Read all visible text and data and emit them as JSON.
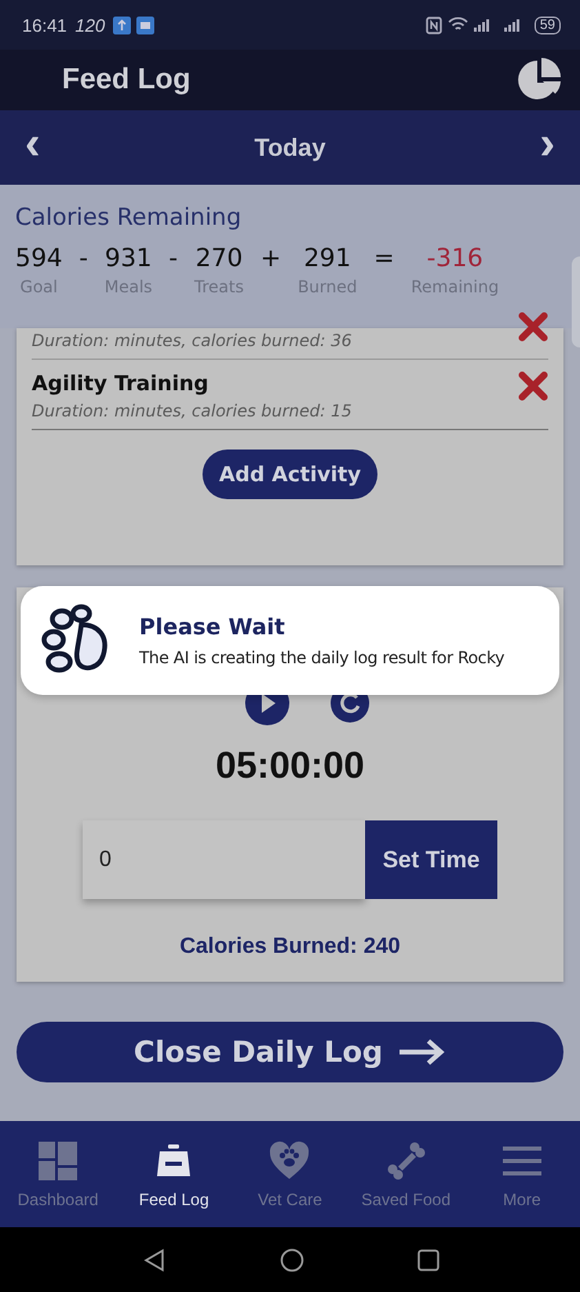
{
  "status_bar": {
    "time": "16:41",
    "refresh_rate": "120",
    "battery": "59"
  },
  "header": {
    "title": "Feed Log"
  },
  "date_nav": {
    "label": "Today",
    "prev": "‹",
    "next": "›"
  },
  "calories": {
    "title": "Calories Remaining",
    "terms": [
      {
        "value": "594",
        "label": "Goal",
        "op": "-",
        "kind": "normal"
      },
      {
        "value": "931",
        "label": "Meals",
        "op": "-",
        "kind": "normal"
      },
      {
        "value": "270",
        "label": "Treats",
        "op": "+",
        "kind": "normal"
      },
      {
        "value": "291",
        "label": "Burned",
        "op": "=",
        "kind": "normal"
      },
      {
        "value": "-316",
        "label": "Remaining",
        "kind": "negative"
      }
    ]
  },
  "activities": [
    {
      "details": "Duration: minutes,  calories burned: 36"
    },
    {
      "name": "Agility Training",
      "details": "Duration: minutes,  calories burned: 15"
    }
  ],
  "add_button": "Add Activity",
  "toast": {
    "title": "Please Wait",
    "message": "The AI is creating the daily log result for Rocky"
  },
  "timer": {
    "time": "05:00:00",
    "input_value": "0",
    "set_button": "Set Time",
    "burned": "Calories Burned: 240"
  },
  "close_button": "Close Daily Log",
  "nav": [
    {
      "label": "Dashboard",
      "kind": "dashboard",
      "selected": false
    },
    {
      "label": "Feed Log",
      "kind": "bowl",
      "selected": true
    },
    {
      "label": "Vet Care",
      "kind": "heart",
      "selected": false
    },
    {
      "label": "Saved Food",
      "kind": "bone",
      "selected": false
    },
    {
      "label": "More",
      "kind": "menu",
      "selected": false
    }
  ]
}
